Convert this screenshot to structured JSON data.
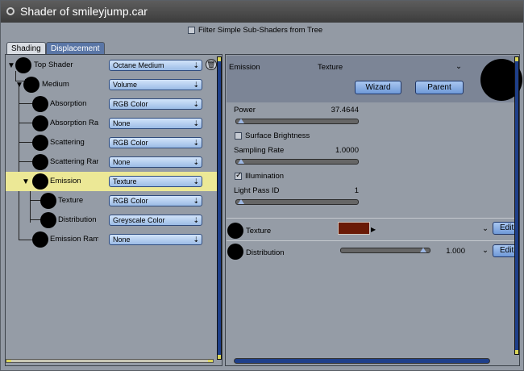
{
  "window": {
    "title": "Shader of smileyjump.car"
  },
  "filter": {
    "label": "Filter Simple Sub-Shaders from Tree",
    "checked": false
  },
  "tabs": [
    {
      "label": "Shading",
      "active": true
    },
    {
      "label": "Displacement",
      "active": false
    }
  ],
  "tree": [
    {
      "label": "Top Shader",
      "value": "Octane Medium"
    },
    {
      "label": "Medium",
      "value": "Volume"
    },
    {
      "label": "Absorption",
      "value": "RGB Color"
    },
    {
      "label": "Absorption Ra",
      "value": "None"
    },
    {
      "label": "Scattering",
      "value": "RGB Color"
    },
    {
      "label": "Scattering Rar",
      "value": "None"
    },
    {
      "label": "Emission",
      "value": "Texture"
    },
    {
      "label": "Texture",
      "value": "RGB Color"
    },
    {
      "label": "Distribution",
      "value": "Greyscale Color"
    },
    {
      "label": "Emission Ram",
      "value": "None"
    }
  ],
  "right": {
    "header_label": "Emission",
    "header_value": "Texture",
    "wizard_label": "Wizard",
    "parent_label": "Parent",
    "power_label": "Power",
    "power_value": "37.4644",
    "surface_brightness_label": "Surface Brightness",
    "surface_brightness_checked": false,
    "sampling_label": "Sampling Rate",
    "sampling_value": "1.0000",
    "illumination_label": "Illumination",
    "illumination_checked": true,
    "lightpass_label": "Light Pass ID",
    "lightpass_value": "1",
    "texture_label": "Texture",
    "texture_color": "#6a1a06",
    "distribution_label": "Distribution",
    "distribution_value": "1.000",
    "edit_label": "Edit"
  },
  "colors": {
    "selected_row": "#ece896",
    "dropdown": "#9cbce6",
    "scroll": "#1e3f8a"
  }
}
